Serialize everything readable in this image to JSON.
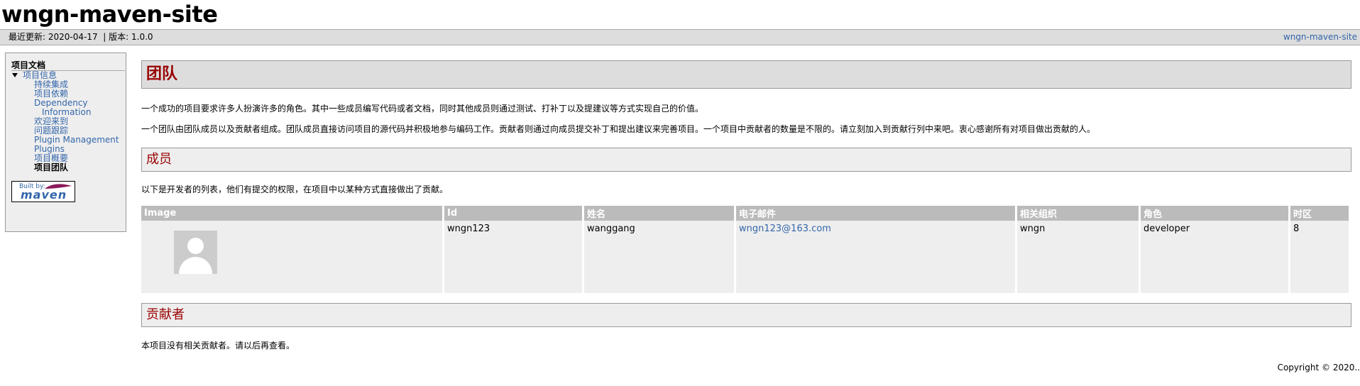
{
  "site": {
    "banner_title": "wngn-maven-site",
    "last_published": "最近更新: 2020-04-17",
    "separator": "|",
    "version": "版本: 1.0.0",
    "right_link": "wngn-maven-site"
  },
  "nav": {
    "heading": "项目文档",
    "project_info": "项目信息",
    "items": [
      "持续集成",
      "项目依赖",
      "Dependency",
      "Information",
      "欢迎来到",
      "问题跟踪",
      "Plugin Management",
      "Plugins",
      "项目概要"
    ],
    "current": "项目团队",
    "powered_by_built": "Built by:",
    "powered_by_maven": "maven"
  },
  "main": {
    "title": "团队",
    "intro1": "一个成功的项目要求许多人扮演许多的角色。其中一些成员编写代码或者文档，同时其他成员则通过测试、打补丁以及提建议等方式实现自己的价值。",
    "intro2": "一个团队由团队成员以及贡献者组成。团队成员直接访问项目的源代码并积极地参与编码工作。贡献者则通过向成员提交补丁和提出建议来完善项目。一个项目中贡献者的数量是不限的。请立刻加入到贡献行列中来吧。衷心感谢所有对项目做出贡献的人。",
    "members_heading": "成员",
    "members_desc": "以下是开发者的列表，他们有提交的权限，在项目中以某种方式直接做出了贡献。",
    "table": {
      "headers": [
        "Image",
        "Id",
        "姓名",
        "电子邮件",
        "相关组织",
        "角色",
        "时区"
      ],
      "rows": [
        {
          "id": "wngn123",
          "name": "wanggang",
          "email": "wngn123@163.com",
          "organization": "wngn",
          "role": "developer",
          "timezone": "8"
        }
      ]
    },
    "contributors_heading": "贡献者",
    "contributors_desc": "本项目没有相关贡献者。请以后再查看。"
  },
  "footer": {
    "copyright": "Copyright © 2020.."
  },
  "colors": {
    "heading_red": "#990000",
    "link_blue": "#3366aa",
    "header_gray": "#dddddd",
    "table_header": "#bbbbbb"
  }
}
